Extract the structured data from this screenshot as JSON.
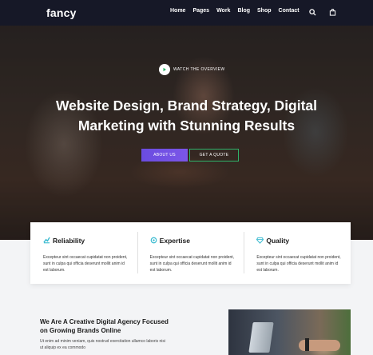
{
  "nav": {
    "logo": "fancy",
    "links": [
      "Home",
      "Pages",
      "Work",
      "Blog",
      "Shop",
      "Contact"
    ],
    "icons": [
      "search-icon",
      "cart-icon"
    ]
  },
  "hero": {
    "watch_label": "WATCH THE OVERVIEW",
    "headline": "Website Design, Brand Strategy, Digital Marketing with Stunning Results",
    "btn_about": "ABOUT US",
    "btn_quote": "GET A QUOTE"
  },
  "features": [
    {
      "title": "Reliability",
      "text": "Excepteur sint occaecat cupidatat non proident, sunt in culpa qui officia deserunt mollit anim id est laborum."
    },
    {
      "title": "Expertise",
      "text": "Excepteur sint occaecat cupidatat non proident, sunt in culpa qui officia deserunt mollit anim id est laborum."
    },
    {
      "title": "Quality",
      "text": "Excepteur sint occaecat cupidatat non proident, sunt in culpa qui officia deserunt mollit anim id est laborum."
    }
  ],
  "about": {
    "title": "We Are A Creative Digital Agency Focused on Growing Brands Online",
    "text": "Ut enim ad minim veniam, quis nostrud exercitation ullamco laboris nisi ut aliquip ex ea commodo"
  },
  "colors": {
    "nav_bg": "#161827",
    "accent_purple": "#6a4ce0",
    "accent_green": "#2fb36a",
    "feature_icon": "#35b9cf"
  }
}
